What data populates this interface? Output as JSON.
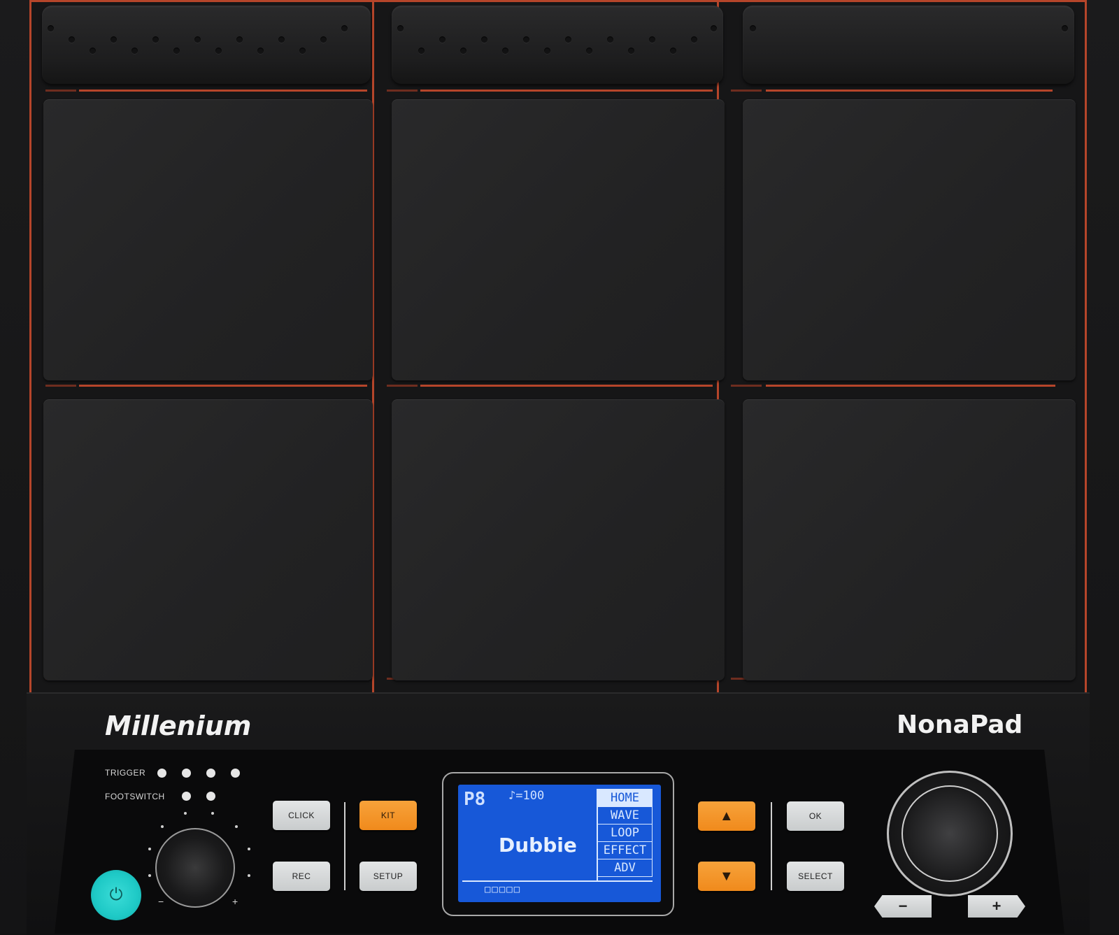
{
  "brand": {
    "left": "Millenium",
    "right": "NonaPad"
  },
  "indicators": {
    "trigger_label": "TRIGGER",
    "footswitch_label": "FOOTSWITCH"
  },
  "buttons": {
    "click": "CLICK",
    "rec": "REC",
    "kit": "KIT",
    "setup": "SETUP",
    "ok": "OK",
    "select": "SELECT",
    "minus": "−",
    "plus": "+"
  },
  "volume_knob": {
    "min_label": "−",
    "max_label": "+"
  },
  "lcd": {
    "kit_number": "P8",
    "tempo": "♪=100",
    "kit_name": "Dubbie",
    "menu": [
      "HOME",
      "WAVE",
      "LOOP",
      "EFFECT",
      "ADV"
    ],
    "status_boxes": "□□□□□"
  },
  "colors": {
    "accent": "#b5452a",
    "orange_button": "#f08a1c",
    "lcd_bg": "#1758d8",
    "power": "#1ec9c6"
  },
  "icons": [
    "power-icon",
    "arrow-up-icon",
    "arrow-down-icon"
  ]
}
